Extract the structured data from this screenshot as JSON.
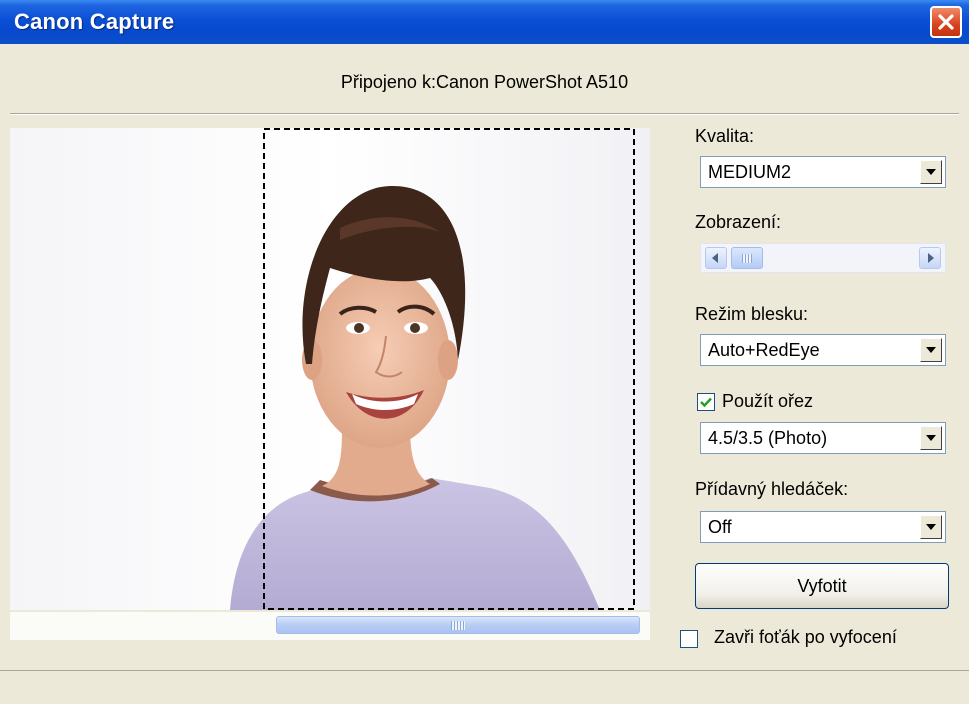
{
  "window": {
    "title": "Canon Capture"
  },
  "status": {
    "connected_text": "Připojeno k:Canon PowerShot A510"
  },
  "controls": {
    "quality": {
      "label": "Kvalita:",
      "value": "MEDIUM2"
    },
    "zoom": {
      "label": "Zobrazení:"
    },
    "flash": {
      "label": "Režim blesku:",
      "value": "Auto+RedEye"
    },
    "crop": {
      "label": "Použít ořez",
      "checked": true,
      "value": "4.5/3.5 (Photo)"
    },
    "viewfinder": {
      "label": "Přídavný hledáček:",
      "value": "Off"
    },
    "capture_button": "Vyfotit",
    "close_after": {
      "label": "Zavři foťák po vyfocení",
      "checked": false
    }
  },
  "icons": [
    "close-icon",
    "checkmark-icon",
    "chevron-down-icon",
    "scroll-left-icon",
    "scroll-right-icon"
  ],
  "colors": {
    "titlebar": "#0a4fd5",
    "window_bg": "#ece9d8",
    "close_button": "#d8421d"
  }
}
